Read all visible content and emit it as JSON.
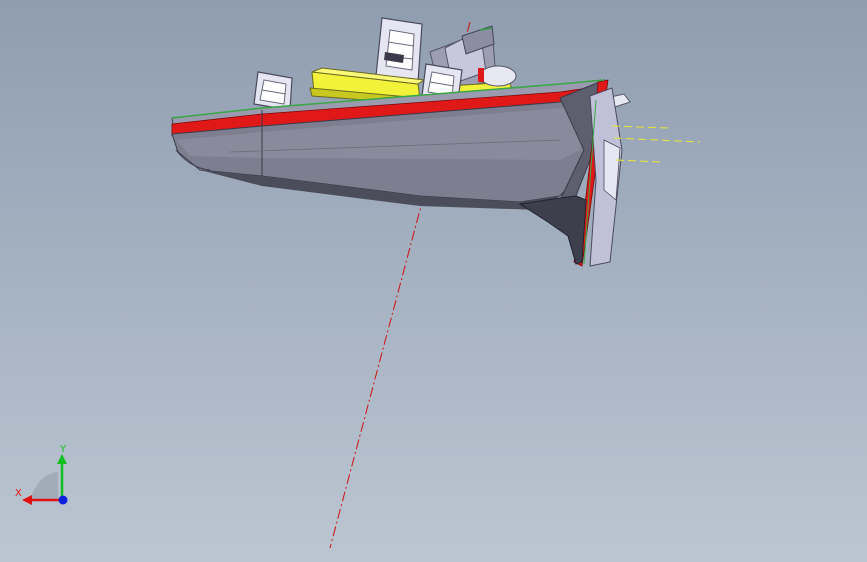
{
  "triad": {
    "x_label": "X",
    "y_label": "Y",
    "x_color": "#e01010",
    "y_color": "#10c020",
    "z_color": "#1020e0"
  },
  "colors": {
    "hull": "#6c6d7c",
    "hull_light": "#9a9bae",
    "stripe": "#e01818",
    "deck_edge": "#3aa845",
    "cabin": "#f2f23a",
    "superstructure": "#d8d8ec",
    "centerline": "#d01010",
    "waterline": "#e8e830"
  }
}
